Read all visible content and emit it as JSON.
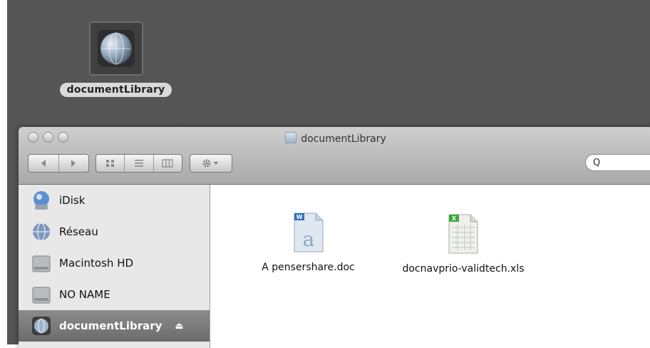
{
  "desktop": {
    "icon_label": "documentLibrary"
  },
  "window": {
    "title": "documentLibrary",
    "toolbar": {
      "back_icon": "back-arrow-icon",
      "forward_icon": "forward-arrow-icon",
      "view_icons": [
        "icon-view-icon",
        "list-view-icon",
        "column-view-icon"
      ],
      "action_icon": "gear-icon",
      "search_icon": "search-icon",
      "search_text": "Q"
    },
    "sidebar": {
      "items": [
        {
          "label": "iDisk",
          "icon": "idisk-icon"
        },
        {
          "label": "Réseau",
          "icon": "network-globe-icon"
        },
        {
          "label": "Macintosh HD",
          "icon": "hard-drive-icon"
        },
        {
          "label": "NO NAME",
          "icon": "hard-drive-icon"
        },
        {
          "label": "documentLibrary",
          "icon": "network-volume-icon",
          "eject": "⏏"
        }
      ]
    },
    "files": [
      {
        "name": "A pensershare.doc",
        "icon": "word-document-icon"
      },
      {
        "name": "docnavprio-validtech.xls",
        "icon": "excel-spreadsheet-icon"
      }
    ]
  },
  "colors": {
    "desktop": "#555555",
    "sidebar_selected": "#7a7a7a",
    "word_accent": "#2f6fc1",
    "excel_accent": "#3fa63a"
  }
}
